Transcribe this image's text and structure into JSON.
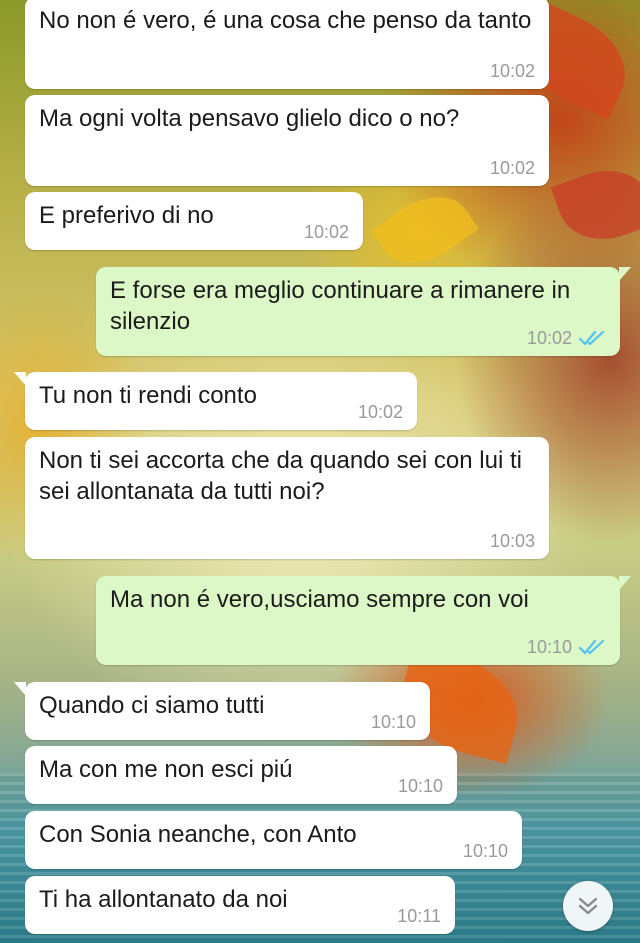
{
  "messages": [
    {
      "dir": "in",
      "text": "No non é vero, é una cosa che penso da tanto",
      "time": "10:02"
    },
    {
      "dir": "in",
      "text": "Ma ogni volta pensavo glielo dico o no?",
      "time": "10:02"
    },
    {
      "dir": "in",
      "text": "E preferivo di no",
      "time": "10:02"
    },
    {
      "dir": "out",
      "text": "E forse era meglio continuare a rimanere in silenzio",
      "time": "10:02",
      "status": "read"
    },
    {
      "dir": "in",
      "text": "Tu non ti rendi conto",
      "time": "10:02"
    },
    {
      "dir": "in",
      "text": "Non ti sei accorta che da quando sei con lui ti sei allontanata da tutti noi?",
      "time": "10:03"
    },
    {
      "dir": "out",
      "text": "Ma non é vero,usciamo sempre con voi",
      "time": "10:10",
      "status": "read"
    },
    {
      "dir": "in",
      "text": "Quando ci siamo tutti",
      "time": "10:10"
    },
    {
      "dir": "in",
      "text": "Ma con me non esci piú",
      "time": "10:10"
    },
    {
      "dir": "in",
      "text": "Con Sonia neanche, con Anto",
      "time": "10:10"
    },
    {
      "dir": "in",
      "text": "Ti ha allontanato da noi",
      "time": "10:11"
    }
  ],
  "colors": {
    "incoming_bubble": "#ffffff",
    "outgoing_bubble": "#dcf8c6",
    "read_ticks": "#4fc3f7",
    "timestamp": "#9a9a9a"
  },
  "icons": {
    "read_receipt": "double-check-icon",
    "scroll_down": "chevron-double-down-icon"
  }
}
